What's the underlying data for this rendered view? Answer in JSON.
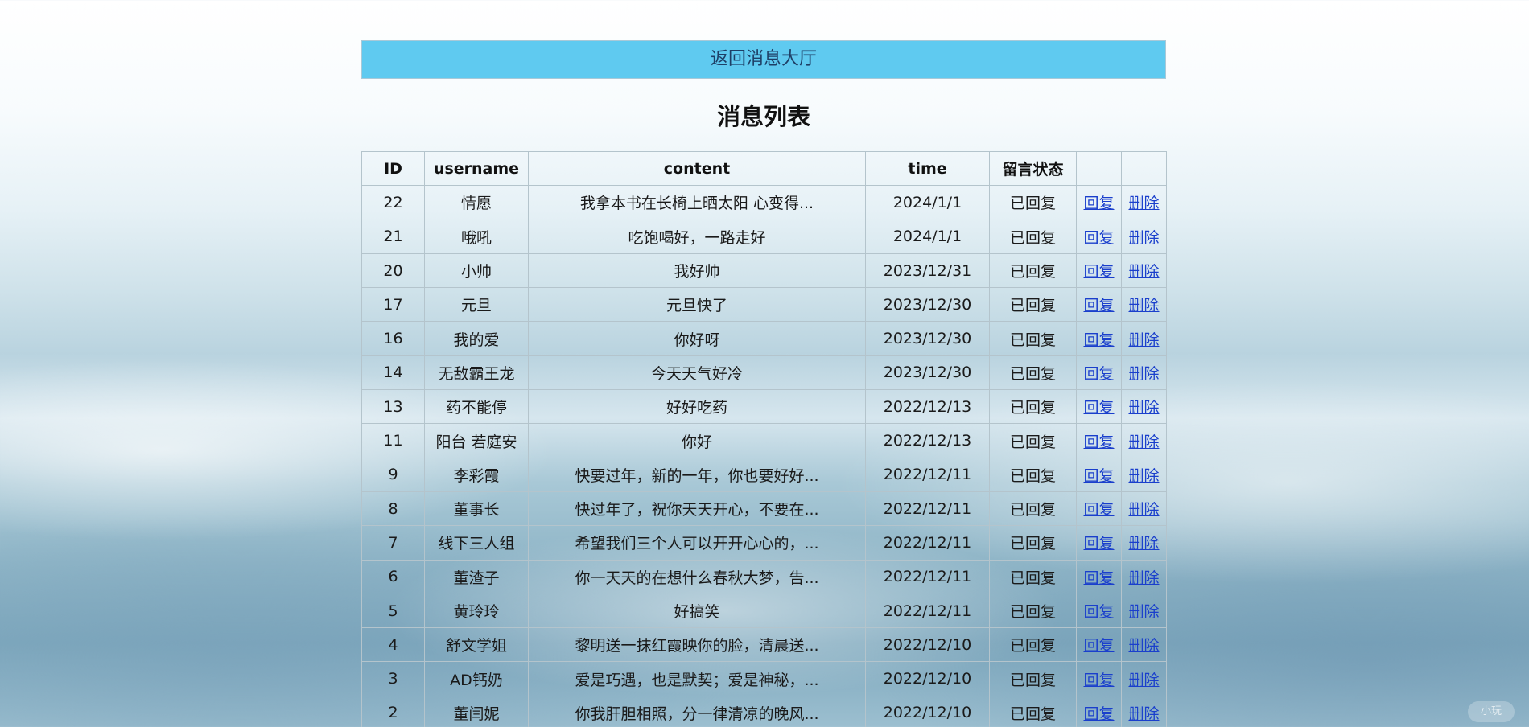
{
  "header": {
    "back_link": "返回消息大厅",
    "title": "消息列表"
  },
  "table": {
    "columns": [
      "ID",
      "username",
      "content",
      "time",
      "留言状态",
      "",
      ""
    ],
    "rows": [
      {
        "id": "22",
        "username": "情愿",
        "content": "我拿本书在长椅上晒太阳 心变得...",
        "time": "2024/1/1",
        "status": "已回复",
        "reply": "回复",
        "delete": "删除"
      },
      {
        "id": "21",
        "username": "哦吼",
        "content": "吃饱喝好，一路走好",
        "time": "2024/1/1",
        "status": "已回复",
        "reply": "回复",
        "delete": "删除"
      },
      {
        "id": "20",
        "username": "小帅",
        "content": "我好帅",
        "time": "2023/12/31",
        "status": "已回复",
        "reply": "回复",
        "delete": "删除"
      },
      {
        "id": "17",
        "username": "元旦",
        "content": "元旦快了",
        "time": "2023/12/30",
        "status": "已回复",
        "reply": "回复",
        "delete": "删除"
      },
      {
        "id": "16",
        "username": "我的爱",
        "content": "你好呀",
        "time": "2023/12/30",
        "status": "已回复",
        "reply": "回复",
        "delete": "删除"
      },
      {
        "id": "14",
        "username": "无敌霸王龙",
        "content": "今天天气好冷",
        "time": "2023/12/30",
        "status": "已回复",
        "reply": "回复",
        "delete": "删除"
      },
      {
        "id": "13",
        "username": "药不能停",
        "content": "好好吃药",
        "time": "2022/12/13",
        "status": "已回复",
        "reply": "回复",
        "delete": "删除"
      },
      {
        "id": "11",
        "username": "阳台 若庭安",
        "content": "你好",
        "time": "2022/12/13",
        "status": "已回复",
        "reply": "回复",
        "delete": "删除"
      },
      {
        "id": "9",
        "username": "李彩霞",
        "content": "快要过年，新的一年，你也要好好...",
        "time": "2022/12/11",
        "status": "已回复",
        "reply": "回复",
        "delete": "删除"
      },
      {
        "id": "8",
        "username": "董事长",
        "content": "快过年了，祝你天天开心，不要在...",
        "time": "2022/12/11",
        "status": "已回复",
        "reply": "回复",
        "delete": "删除"
      },
      {
        "id": "7",
        "username": "线下三人组",
        "content": "希望我们三个人可以开开心心的，...",
        "time": "2022/12/11",
        "status": "已回复",
        "reply": "回复",
        "delete": "删除"
      },
      {
        "id": "6",
        "username": "董渣子",
        "content": "你一天天的在想什么春秋大梦，告...",
        "time": "2022/12/11",
        "status": "已回复",
        "reply": "回复",
        "delete": "删除"
      },
      {
        "id": "5",
        "username": "黄玲玲",
        "content": "好搞笑",
        "time": "2022/12/11",
        "status": "已回复",
        "reply": "回复",
        "delete": "删除"
      },
      {
        "id": "4",
        "username": "舒文学姐",
        "content": "黎明送一抹红霞映你的脸，清晨送...",
        "time": "2022/12/10",
        "status": "已回复",
        "reply": "回复",
        "delete": "删除"
      },
      {
        "id": "3",
        "username": "AD钙奶",
        "content": "爱是巧遇，也是默契；爱是神秘，...",
        "time": "2022/12/10",
        "status": "已回复",
        "reply": "回复",
        "delete": "删除"
      },
      {
        "id": "2",
        "username": "董闫妮",
        "content": "你我肝胆相照，分一律清凉的晚风...",
        "time": "2022/12/10",
        "status": "已回复",
        "reply": "回复",
        "delete": "删除"
      }
    ]
  },
  "watermark": "小玩",
  "colors": {
    "back_bar": "#5fcaf0",
    "link": "#1a3fcc",
    "border": "#b4c4cc"
  }
}
